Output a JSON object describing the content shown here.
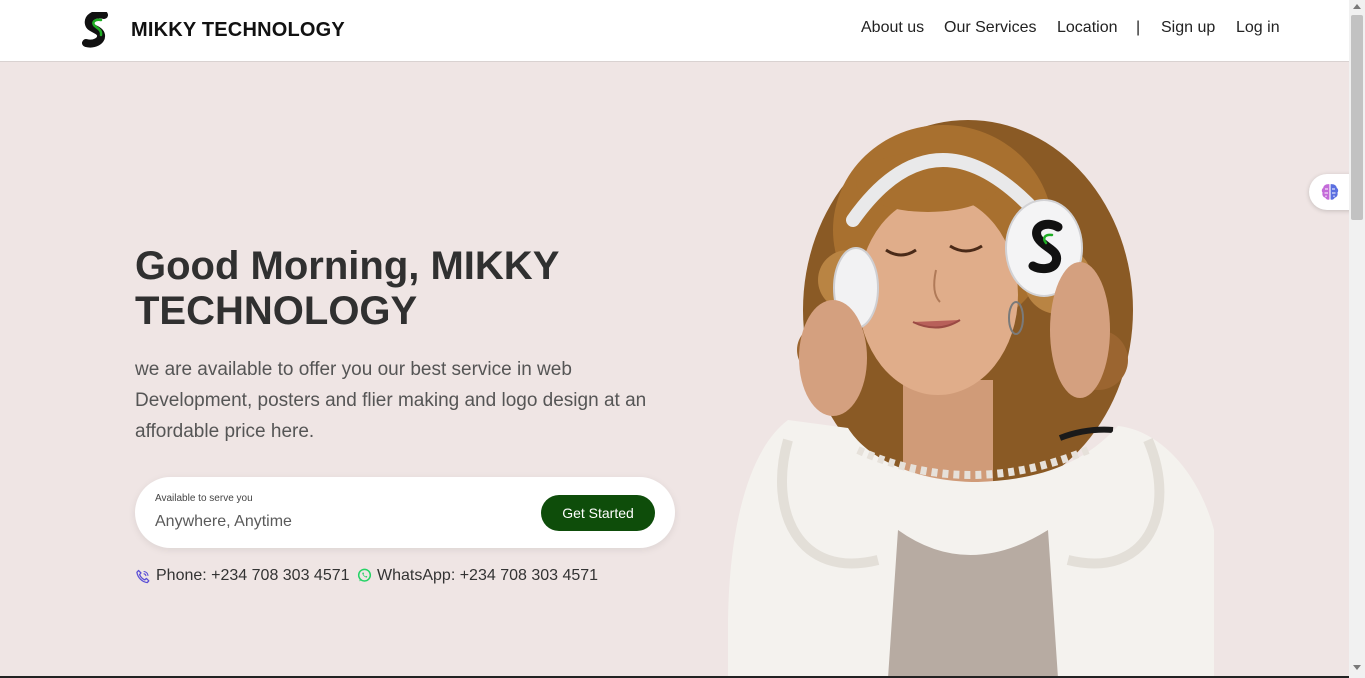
{
  "header": {
    "brand_name": "MIKKY TECHNOLOGY",
    "logo_icon": "s-logo-icon",
    "nav": {
      "about": "About us",
      "services": "Our Services",
      "location": "Location",
      "separator": "|",
      "signup": "Sign up",
      "login": "Log in"
    }
  },
  "hero": {
    "title": "Good Morning, MIKKY TECHNOLOGY",
    "description": "we are available to offer you our best service in web Development, posters and flier making and logo design at an affordable price here.",
    "search": {
      "label": "Available to serve you",
      "placeholder": "Anywhere, Anytime",
      "button": "Get Started"
    },
    "contact": {
      "phone": "Phone: +234 708 303 4571",
      "whatsapp": "WhatsApp: +234 708 303 4571"
    },
    "image_icon": "woman-with-headphones-illustration"
  },
  "widget_icon": "brain-icon",
  "colors": {
    "background": "#efe5e4",
    "accent_button": "#0e4d0a",
    "brand_green": "#1fae24",
    "phone_icon": "#5b4fd6",
    "whatsapp_icon": "#25d366"
  }
}
